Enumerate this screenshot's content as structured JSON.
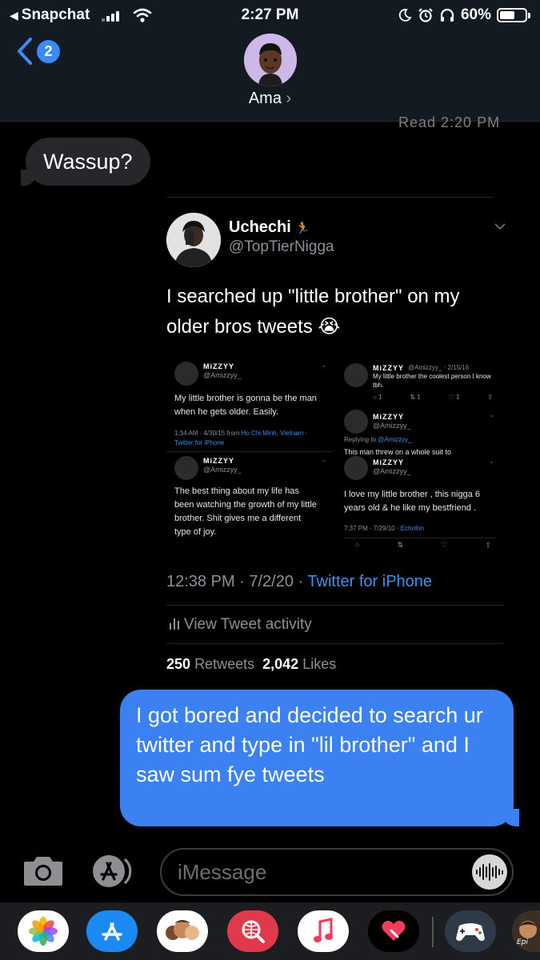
{
  "status_bar": {
    "back_app": "Snapchat",
    "time": "2:27 PM",
    "battery": "60%",
    "battery_level": 0.6
  },
  "nav": {
    "back_badge": "2",
    "contact_name": "Ama"
  },
  "conversation": {
    "read_receipt_partial": "Read 2:20 PM",
    "incoming_message": "Wassup?",
    "outgoing_message": "I got bored and decided to search ur twitter and type in \"lil brother\" and I saw sum fye tweets"
  },
  "tweet": {
    "display_name": "Uchechi",
    "handle": "@TopTierNigga",
    "text": "I searched up \"little brother\" on my older bros tweets 😭",
    "time": "12:38 PM · 7/2/20 · ",
    "source": "Twitter for iPhone",
    "activity_label": "View Tweet activity",
    "retweets_count": "250",
    "retweets_label": "Retweets",
    "likes_count": "2,042",
    "likes_label": "Likes",
    "embedded_tweets": {
      "a": {
        "name": "MiZZYY",
        "handle": "@Amizzyy_",
        "text": "My little brother is gonna be the man when he gets older. Easily.",
        "meta": "1:34 AM · 4/30/15 from ",
        "location": "Ho Chi Minh, Vietnam",
        "meta_suffix": " ·",
        "source": "Twitter for iPhone"
      },
      "b": {
        "name": "MiZZYY",
        "handle": "@Amizzyy_",
        "text": "The best thing about my life has been watching the growth of my little brother. Shit gives me a different type of joy."
      },
      "c": {
        "name": "MiZZYY",
        "handle": "@Amizzyy_ · 2/15/16",
        "text": "My little brother the coolest person I know tbh.",
        "reply_count": "1",
        "retweet_count": "1",
        "like_count": "1"
      },
      "d": {
        "name": "MiZZYY",
        "handle": "@Amizzyy_",
        "reply_prefix": "Replying to ",
        "reply_to": "@Amizzyy_",
        "cut_text": "This man threw on a whole suit to"
      },
      "e": {
        "name": "MiZZYY",
        "handle": "@Amizzyy_",
        "text": "I love my little brother , this nigga 6 years old & he like my bestfriend .",
        "meta": "7:37 PM · 7/29/10 · ",
        "source": "Echofon"
      }
    }
  },
  "input": {
    "placeholder": "iMessage"
  },
  "app_drawer": {
    "apps": [
      "photos-app",
      "app-store",
      "memoji-stickers",
      "web-search",
      "music",
      "digital-touch",
      "game-pigeon",
      "epic-stickers"
    ]
  },
  "colors": {
    "outgoing_bubble": "#3c81f1",
    "incoming_bubble": "#26272b",
    "link_blue": "#3d92e6",
    "badge_blue": "#3b8af5"
  }
}
